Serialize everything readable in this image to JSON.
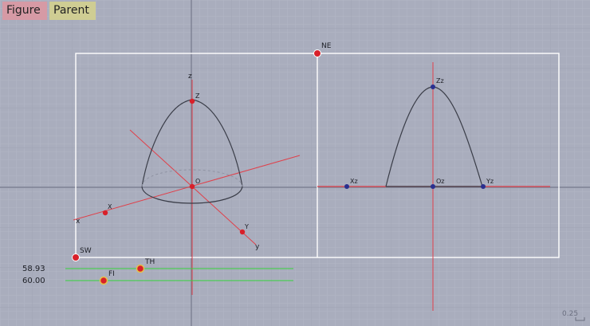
{
  "toolbar": {
    "figure_label": "Figure",
    "parent_label": "Parent",
    "figure_color": "#d69aa5",
    "parent_color": "#cfcd93"
  },
  "colors": {
    "background": "#a9adbd",
    "grid_minor": "#b3b7c6",
    "grid_major": "#9da1b2",
    "axis": "#7d8193",
    "frame": "#ffffff",
    "ray": "#e0404a",
    "curve": "#3a3d48",
    "dashed": "#8f93a3",
    "control_line": "#35d43c",
    "point_red": "#d8202a",
    "point_blue": "#2a2f8f"
  },
  "labels": {
    "ne": "NE",
    "sw": "SW",
    "th": "TH",
    "fi": "FI",
    "z_axis": "z",
    "z_point": "Z",
    "o_point": "O",
    "x_axis": "x",
    "x_point": "X",
    "y_point": "Y",
    "y_axis": "y",
    "xz": "Xz",
    "oz": "Oz",
    "yz": "Yz",
    "zz": "Zz"
  },
  "values": {
    "th_value": "58.93",
    "fi_value": "60.00"
  },
  "scale": {
    "label": "0.25"
  }
}
